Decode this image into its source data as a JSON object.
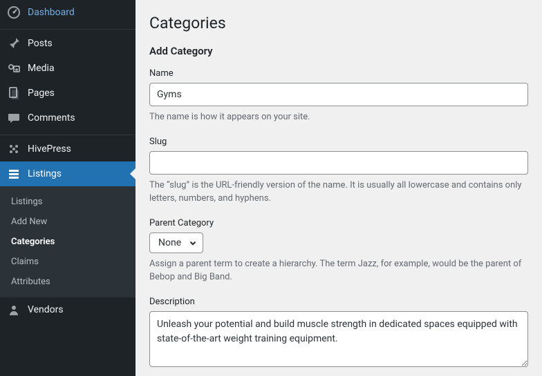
{
  "sidebar": {
    "dashboard": "Dashboard",
    "posts": "Posts",
    "media": "Media",
    "pages": "Pages",
    "comments": "Comments",
    "hivepress": "HivePress",
    "listings": "Listings",
    "vendors": "Vendors"
  },
  "submenu": {
    "listings": "Listings",
    "addnew": "Add New",
    "categories": "Categories",
    "claims": "Claims",
    "attributes": "Attributes"
  },
  "page": {
    "title": "Categories",
    "formTitle": "Add Category"
  },
  "fields": {
    "name": {
      "label": "Name",
      "value": "Gyms",
      "help": "The name is how it appears on your site."
    },
    "slug": {
      "label": "Slug",
      "value": "",
      "help": "The “slug” is the URL-friendly version of the name. It is usually all lowercase and contains only letters, numbers, and hyphens."
    },
    "parent": {
      "label": "Parent Category",
      "selected": "None",
      "help": "Assign a parent term to create a hierarchy. The term Jazz, for example, would be the parent of Bebop and Big Band."
    },
    "description": {
      "label": "Description",
      "value": "Unleash your potential and build muscle strength in dedicated spaces equipped with state-of-the-art weight training equipment."
    }
  }
}
